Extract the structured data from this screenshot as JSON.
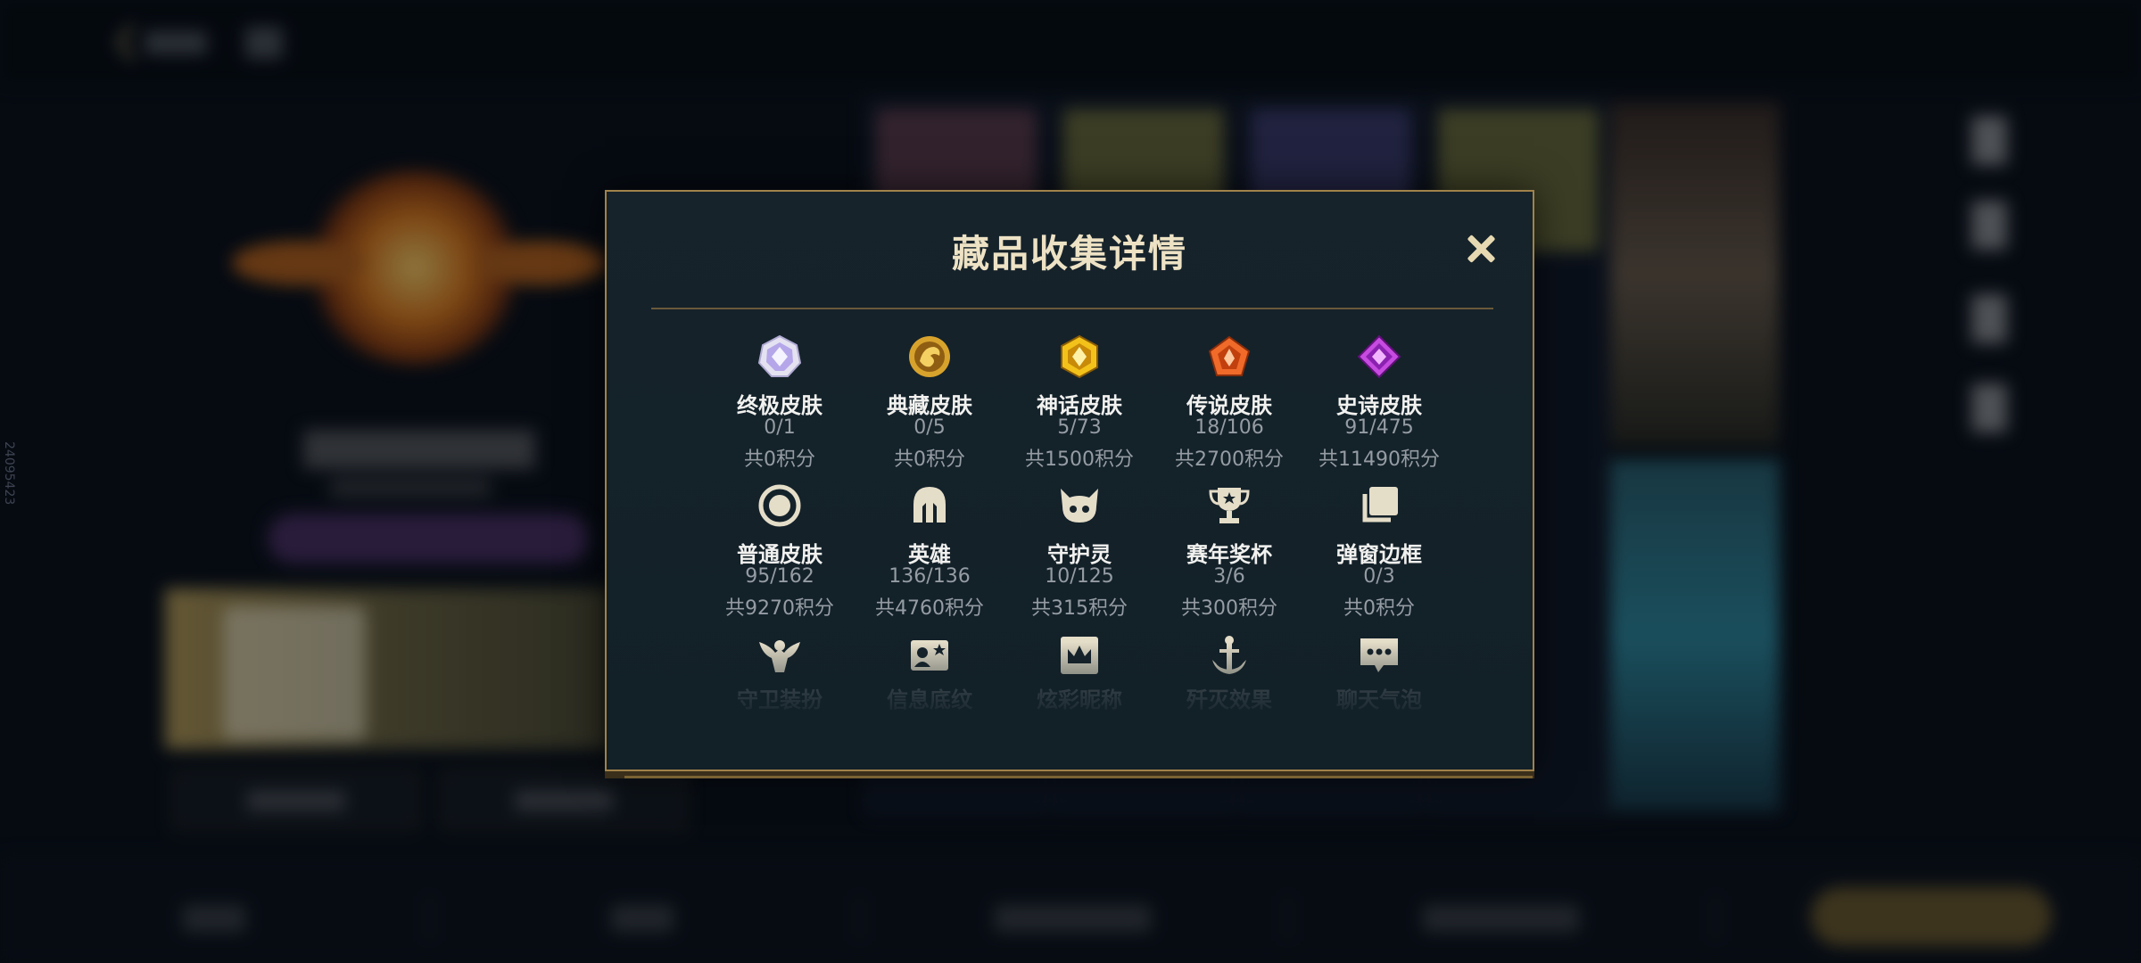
{
  "background": {
    "side_watermark": "24095423"
  },
  "modal": {
    "title": "藏品收集详情",
    "close_icon": "close-icon",
    "accent_color": "#a1824a",
    "items": [
      {
        "name": "终极皮肤",
        "count": "0/1",
        "points": "共0积分",
        "icon": "ultimate-skin-gem-icon"
      },
      {
        "name": "典藏皮肤",
        "count": "0/5",
        "points": "共0积分",
        "icon": "collector-skin-dragon-icon"
      },
      {
        "name": "神话皮肤",
        "count": "5/73",
        "points": "共1500积分",
        "icon": "mythic-skin-gem-icon"
      },
      {
        "name": "传说皮肤",
        "count": "18/106",
        "points": "共2700积分",
        "icon": "legendary-skin-gem-icon"
      },
      {
        "name": "史诗皮肤",
        "count": "91/475",
        "points": "共11490积分",
        "icon": "epic-skin-gem-icon"
      },
      {
        "name": "普通皮肤",
        "count": "95/162",
        "points": "共9270积分",
        "icon": "normal-skin-ring-icon"
      },
      {
        "name": "英雄",
        "count": "136/136",
        "points": "共4760积分",
        "icon": "hero-helmet-icon"
      },
      {
        "name": "守护灵",
        "count": "10/125",
        "points": "共315积分",
        "icon": "guardian-spirit-icon"
      },
      {
        "name": "赛年奖杯",
        "count": "3/6",
        "points": "共300积分",
        "icon": "season-trophy-icon"
      },
      {
        "name": "弹窗边框",
        "count": "0/3",
        "points": "共0积分",
        "icon": "popup-frame-icon"
      },
      {
        "name": "守卫装扮",
        "icon": "guard-outfit-icon"
      },
      {
        "name": "信息底纹",
        "icon": "info-background-icon"
      },
      {
        "name": "炫彩昵称",
        "icon": "colorful-nickname-icon"
      },
      {
        "name": "歼灭效果",
        "icon": "annihilation-effect-icon"
      },
      {
        "name": "聊天气泡",
        "icon": "chat-bubble-icon"
      }
    ]
  }
}
